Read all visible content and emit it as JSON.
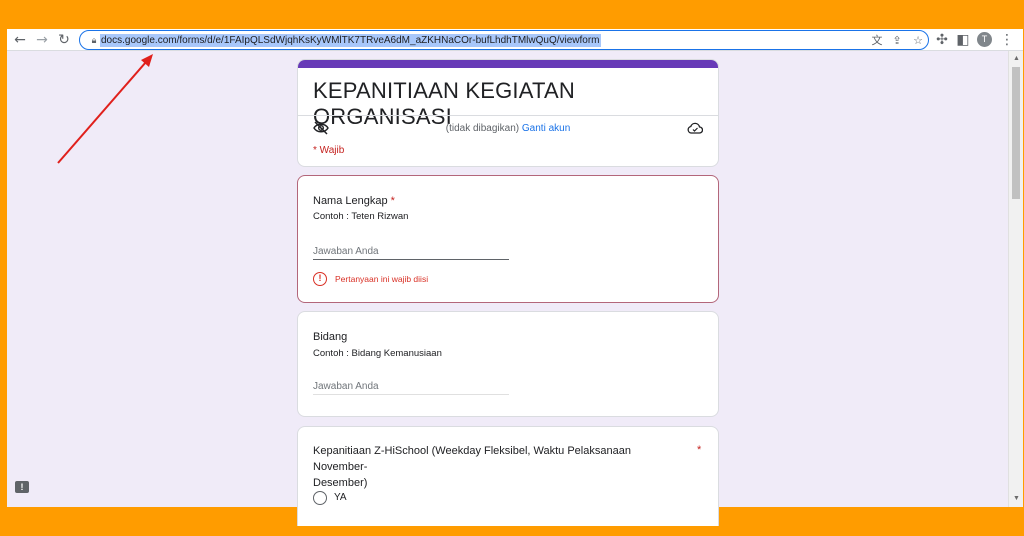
{
  "browser": {
    "url": "docs.google.com/forms/d/e/1FAIpQLSdWjqhKsKyWMlTK7TRveA6dM_aZKHNaCOr-bufLhdhTMlwQuQ/viewform",
    "profile_initial": "T",
    "icons": [
      "back-icon",
      "forward-icon",
      "reload-icon",
      "lock-icon",
      "translate-icon",
      "share-icon",
      "star-icon",
      "extensions-icon",
      "side-panel-icon",
      "menu-icon"
    ]
  },
  "form": {
    "title": "KEPANITIAAN KEGIATAN ORGANISASI",
    "account_status": "(tidak dibagikan)",
    "switch_account": "Ganti akun",
    "required_note": "* Wajib"
  },
  "questions": [
    {
      "title": "Nama Lengkap",
      "required_mark": "*",
      "description": "Contoh : Teten Rizwan",
      "placeholder": "Jawaban Anda",
      "error": "Pertanyaan ini wajib diisi"
    },
    {
      "title": "Bidang",
      "description": "Contoh : Bidang Kemanusiaan",
      "placeholder": "Jawaban Anda"
    },
    {
      "title_line1": "Kepanitiaan Z-HiSchool (Weekday Fleksibel, Waktu Pelaksanaan November-",
      "title_line2": "Desember)",
      "required_mark": "*",
      "options": [
        "YA"
      ]
    }
  ],
  "colors": {
    "accent": "#673ab7",
    "error": "#d93025",
    "link": "#1a73e8",
    "background": "#f0ebf8",
    "outer_frame": "#ff9c00",
    "annotation_arrow": "#e0201c"
  }
}
